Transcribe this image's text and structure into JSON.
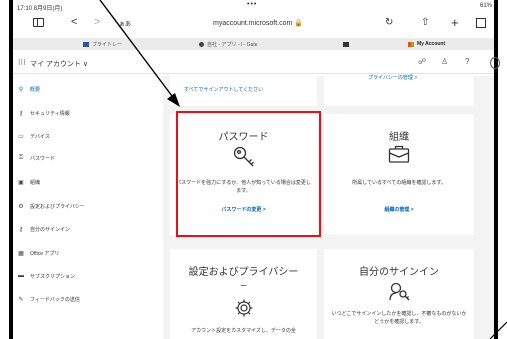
{
  "status_bar": {
    "time": "17:10  8月9日(月)",
    "dots": "•••",
    "battery": "61%"
  },
  "address_bar": {
    "text_size": "ぁあ",
    "url": "myaccount.microsoft.com 🔒",
    "back": "<",
    "forward": ">",
    "reload": "↻",
    "share": "⇧",
    "new_tab": "+"
  },
  "tabs": [
    {
      "label": "ブライトレー",
      "color": "#2b579a"
    },
    {
      "label": "自社 - アプリ - I - Gate",
      "color": "#444444"
    },
    {
      "label": "",
      "color": "#333333"
    },
    {
      "label": "My Account",
      "color": "#f25022"
    }
  ],
  "app_header": {
    "grid_icon": "app-grid-icon",
    "title": "マイ アカウント ∨"
  },
  "sidebar": {
    "items": [
      {
        "label": "概要",
        "icon": "person-icon",
        "glyph": "⚲"
      },
      {
        "label": "セキュリティ情報",
        "icon": "security-key-icon",
        "glyph": "⚷"
      },
      {
        "label": "デバイス",
        "icon": "laptop-icon",
        "glyph": "▭"
      },
      {
        "label": "パスワード",
        "icon": "key-icon",
        "glyph": "⚿"
      },
      {
        "label": "組織",
        "icon": "briefcase-icon",
        "glyph": "▣"
      },
      {
        "label": "設定およびプライバシー",
        "icon": "settings-icon",
        "glyph": "⚙"
      },
      {
        "label": "自分のサインイン",
        "icon": "sign-in-icon",
        "glyph": "⚷"
      },
      {
        "label": "Office アプリ",
        "icon": "office-icon",
        "glyph": "▦"
      },
      {
        "label": "サブスクリプション",
        "icon": "subscription-icon",
        "glyph": "▬"
      },
      {
        "label": "フィードバックの送信",
        "icon": "feedback-icon",
        "glyph": "✎"
      }
    ]
  },
  "cards": {
    "top_left": {
      "link": "すべてでサインアウトしてください"
    },
    "top_right": {
      "link": "プライバシーの管理 >"
    },
    "password": {
      "title": "パスワード",
      "desc": "パスワードを強力にするか、他人が知っている場合は変更します。",
      "link": "パスワードの変更 >"
    },
    "organization": {
      "title": "組織",
      "desc": "所属しているすべての組織を確認します。",
      "link": "組織の管理 >"
    },
    "settings": {
      "title": "設定およびプライバシー",
      "desc": "アカウント設定をカスタマイズし、データの全"
    },
    "signin": {
      "title": "自分のサインイン",
      "desc": "いつどこでサインインしたかを確認し、不審なものがないかどうかを確認します。"
    }
  },
  "colors": {
    "accent": "#0067b8",
    "highlight": "#e5101a",
    "bg": "#f3f3f3"
  }
}
